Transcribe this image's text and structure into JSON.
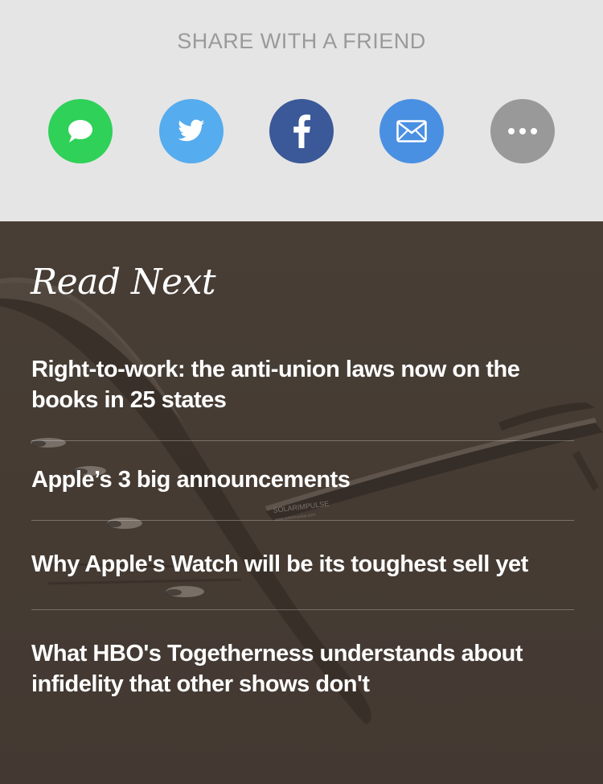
{
  "share": {
    "title": "SHARE WITH A FRIEND",
    "buttons": [
      {
        "name": "messages",
        "icon": "speech-bubble-icon",
        "color": "#2fd158"
      },
      {
        "name": "twitter",
        "icon": "twitter-bird-icon",
        "color": "#55acee"
      },
      {
        "name": "facebook",
        "icon": "facebook-f-icon",
        "color": "#3b5998"
      },
      {
        "name": "email",
        "icon": "envelope-icon",
        "color": "#4a90e2"
      },
      {
        "name": "more",
        "icon": "more-dots-icon",
        "color": "#999999"
      }
    ]
  },
  "read_next": {
    "title": "Read Next",
    "stories": [
      {
        "headline": "Right-to-work: the anti-union laws now on the books in 25 states"
      },
      {
        "headline": "Apple’s 3 big announcements"
      },
      {
        "headline": "Why Apple's Watch will be its toughest sell yet"
      },
      {
        "headline": "What HBO's Togetherness understands about infidelity that other shows don't"
      }
    ],
    "background_image": {
      "aircraft_text": "SOLARIMPULSE",
      "aircraft_sub_text": "www.solarimpulse.com"
    }
  }
}
